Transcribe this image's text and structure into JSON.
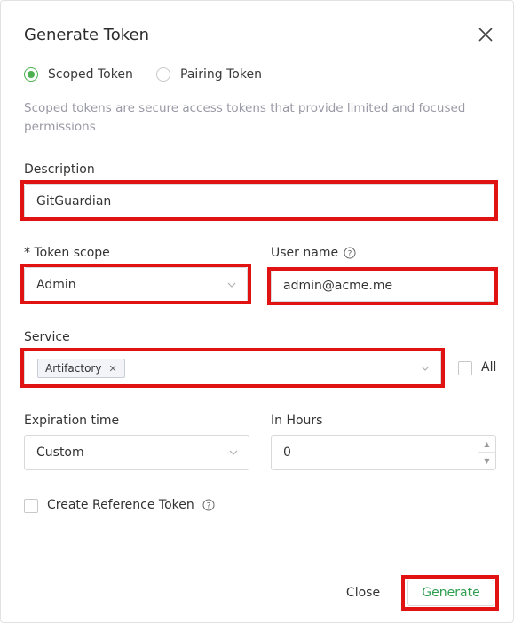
{
  "dialog": {
    "title": "Generate Token"
  },
  "token_type": {
    "options": [
      {
        "label": "Scoped Token",
        "selected": true
      },
      {
        "label": "Pairing Token",
        "selected": false
      }
    ],
    "description": "Scoped tokens are secure access tokens that provide limited and focused permissions"
  },
  "form": {
    "description": {
      "label": "Description",
      "value": "GitGuardian"
    },
    "token_scope": {
      "label": "* Token scope",
      "value": "Admin"
    },
    "user_name": {
      "label": "User name",
      "value": "admin@acme.me"
    },
    "service": {
      "label": "Service",
      "tags": [
        "Artifactory"
      ],
      "all_label": "All",
      "all_checked": false
    },
    "expiration_time": {
      "label": "Expiration time",
      "value": "Custom"
    },
    "in_hours": {
      "label": "In Hours",
      "value": "0"
    },
    "reference_token": {
      "label": "Create Reference Token",
      "checked": false
    }
  },
  "footer": {
    "close_label": "Close",
    "generate_label": "Generate"
  },
  "colors": {
    "accent_green": "#4caf50",
    "generate_text": "#2e9e4f",
    "highlight_red": "#e01212"
  }
}
